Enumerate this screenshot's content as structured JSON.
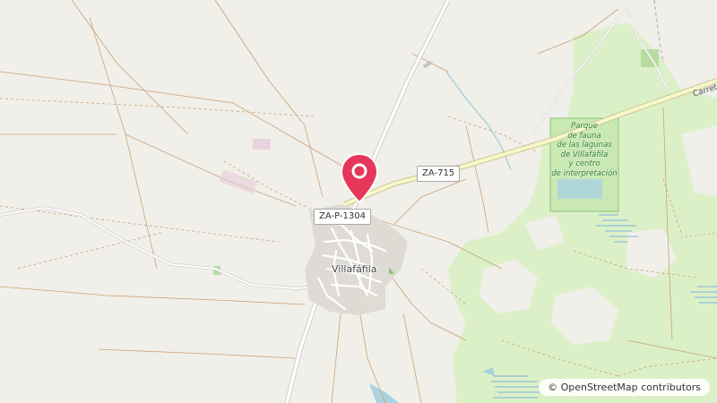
{
  "map": {
    "roads": {
      "main_route": "ZA-715",
      "local_route": "ZA-P-1304",
      "carretera": "Carretera"
    },
    "places": {
      "town": "Villafáfila"
    },
    "park": {
      "lines": [
        "Parque",
        "de fauna",
        "de las lagunas",
        "de Villafáfila",
        "y centro",
        "de interpretación"
      ]
    },
    "attribution": {
      "symbol": "©",
      "text": "OpenStreetMap contributors"
    },
    "marker": {
      "color": "#e6365a",
      "icon": "map-pin-icon"
    },
    "colors": {
      "land": "#f1efe9",
      "green": "#dcf0c8",
      "water": "#aad3df",
      "road_major": "#f7f8c9"
    }
  }
}
